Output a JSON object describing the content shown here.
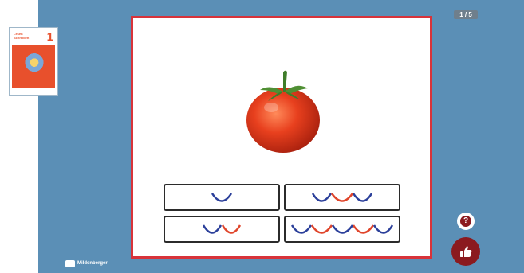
{
  "app": {
    "page_counter": "1 / 5",
    "publisher": "Mildenberger",
    "book": {
      "number": "1"
    }
  },
  "exercise": {
    "image": "tomato",
    "options": [
      {
        "id": "opt1",
        "arcs": [
          "blue"
        ]
      },
      {
        "id": "opt2",
        "arcs": [
          "blue",
          "red",
          "blue"
        ]
      },
      {
        "id": "opt3",
        "arcs": [
          "blue",
          "red"
        ]
      },
      {
        "id": "opt4",
        "arcs": [
          "blue",
          "red",
          "blue",
          "red",
          "blue"
        ]
      }
    ]
  },
  "controls": {
    "help_label": "?",
    "help_icon": "question-icon",
    "like_icon": "thumbs-up-icon"
  },
  "colors": {
    "background": "#5b8fb6",
    "card_border": "#d8333a",
    "arc_blue": "#2b3f9a",
    "arc_red": "#e0452b",
    "button_dark_red": "#8b1a1f"
  }
}
